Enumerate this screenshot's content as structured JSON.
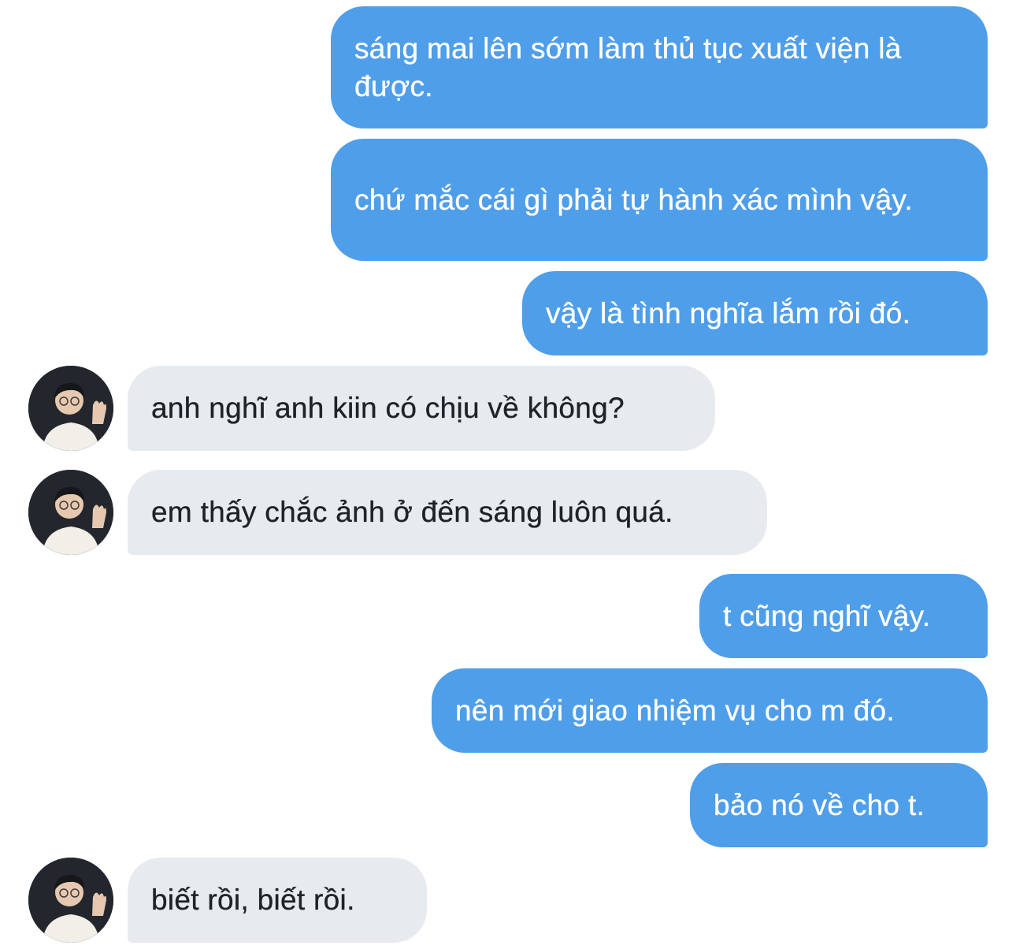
{
  "conversation": {
    "messages": [
      {
        "sender": "me",
        "text": "sáng mai lên sớm làm thủ tục xuất viện là được."
      },
      {
        "sender": "me",
        "text": "chứ mắc cái gì phải tự hành xác mình vậy."
      },
      {
        "sender": "me",
        "text": "vậy là tình nghĩa lắm rồi đó."
      },
      {
        "sender": "other",
        "text": "anh nghĩ anh kiin có chịu về không?"
      },
      {
        "sender": "other",
        "text": "em thấy chắc ảnh ở đến sáng luôn quá."
      },
      {
        "sender": "me",
        "text": "t cũng nghĩ vậy."
      },
      {
        "sender": "me",
        "text": "nên mới giao nhiệm vụ cho m đó."
      },
      {
        "sender": "me",
        "text": "bảo nó về cho t."
      },
      {
        "sender": "other",
        "text": "biết rồi, biết rồi."
      }
    ]
  },
  "colors": {
    "outgoing_bubble": "#4f9ee9",
    "incoming_bubble": "#e7ebef",
    "outgoing_text": "#ffffff",
    "incoming_text": "#1f2328"
  },
  "icons": {
    "avatar": "user-avatar-photo"
  }
}
